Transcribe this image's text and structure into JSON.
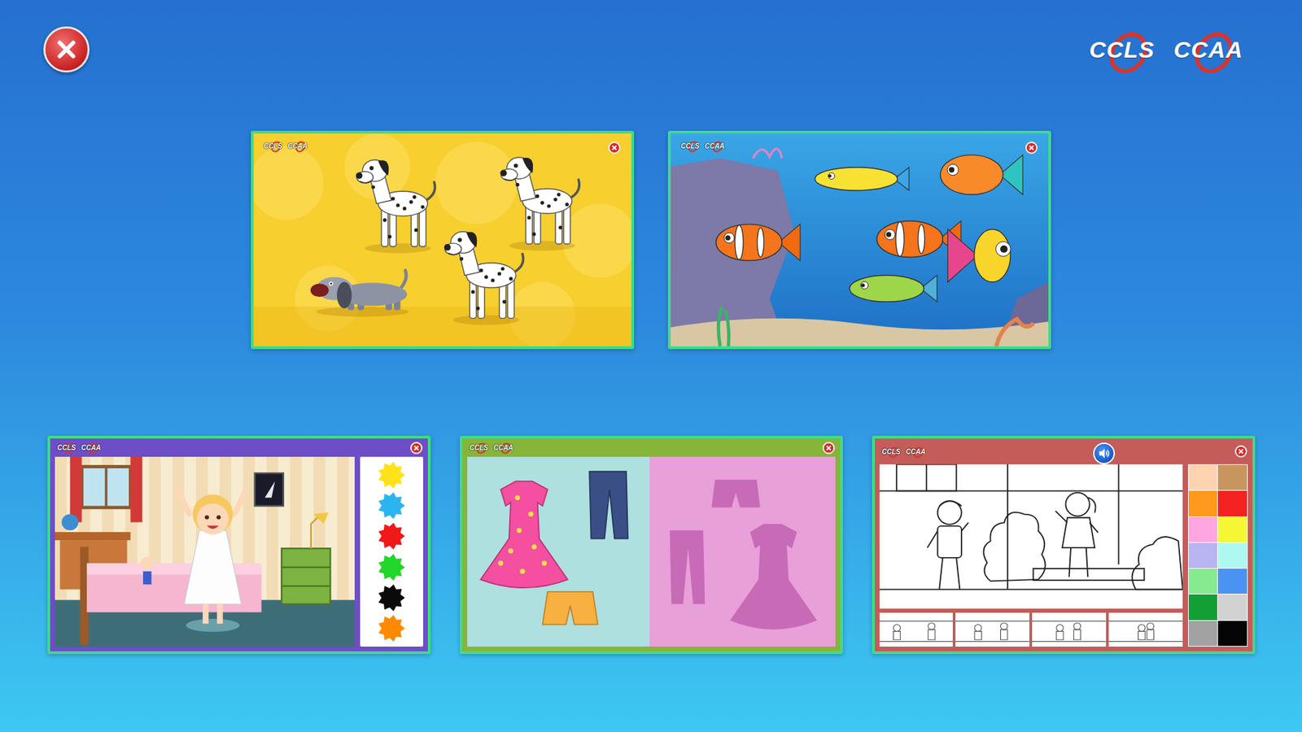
{
  "logo": [
    "CCLS",
    "CCAA"
  ],
  "cards": [
    {
      "kind": "dogs",
      "logo": [
        "CCLS",
        "CCAA"
      ]
    },
    {
      "kind": "fish",
      "logo": [
        "CCLS",
        "CCAA"
      ]
    },
    {
      "kind": "room",
      "logo": [
        "CCLS",
        "CCAA"
      ],
      "palette": [
        {
          "color": "#ffe21a"
        },
        {
          "color": "#2bb5f0"
        },
        {
          "color": "#f01818"
        },
        {
          "color": "#22d62a"
        },
        {
          "color": "#0a0a0a"
        },
        {
          "color": "#ff8a00"
        }
      ]
    },
    {
      "kind": "clothes",
      "logo": [
        "CCLS",
        "CCAA"
      ]
    },
    {
      "kind": "coloring",
      "logo": [
        "CCLS",
        "CCAA"
      ],
      "palette": [
        {
          "color": "#fdd3b0"
        },
        {
          "color": "#c9955e"
        },
        {
          "color": "#ff9a1c"
        },
        {
          "color": "#f52222"
        },
        {
          "color": "#ffa6e0"
        },
        {
          "color": "#f6f734"
        },
        {
          "color": "#b9b4f2"
        },
        {
          "color": "#aef8f2"
        },
        {
          "color": "#86ea90"
        },
        {
          "color": "#4b93f2"
        },
        {
          "color": "#12a034"
        },
        {
          "color": "#d2d2d2"
        },
        {
          "color": "#a2a2a2"
        },
        {
          "color": "#050505"
        }
      ]
    }
  ]
}
